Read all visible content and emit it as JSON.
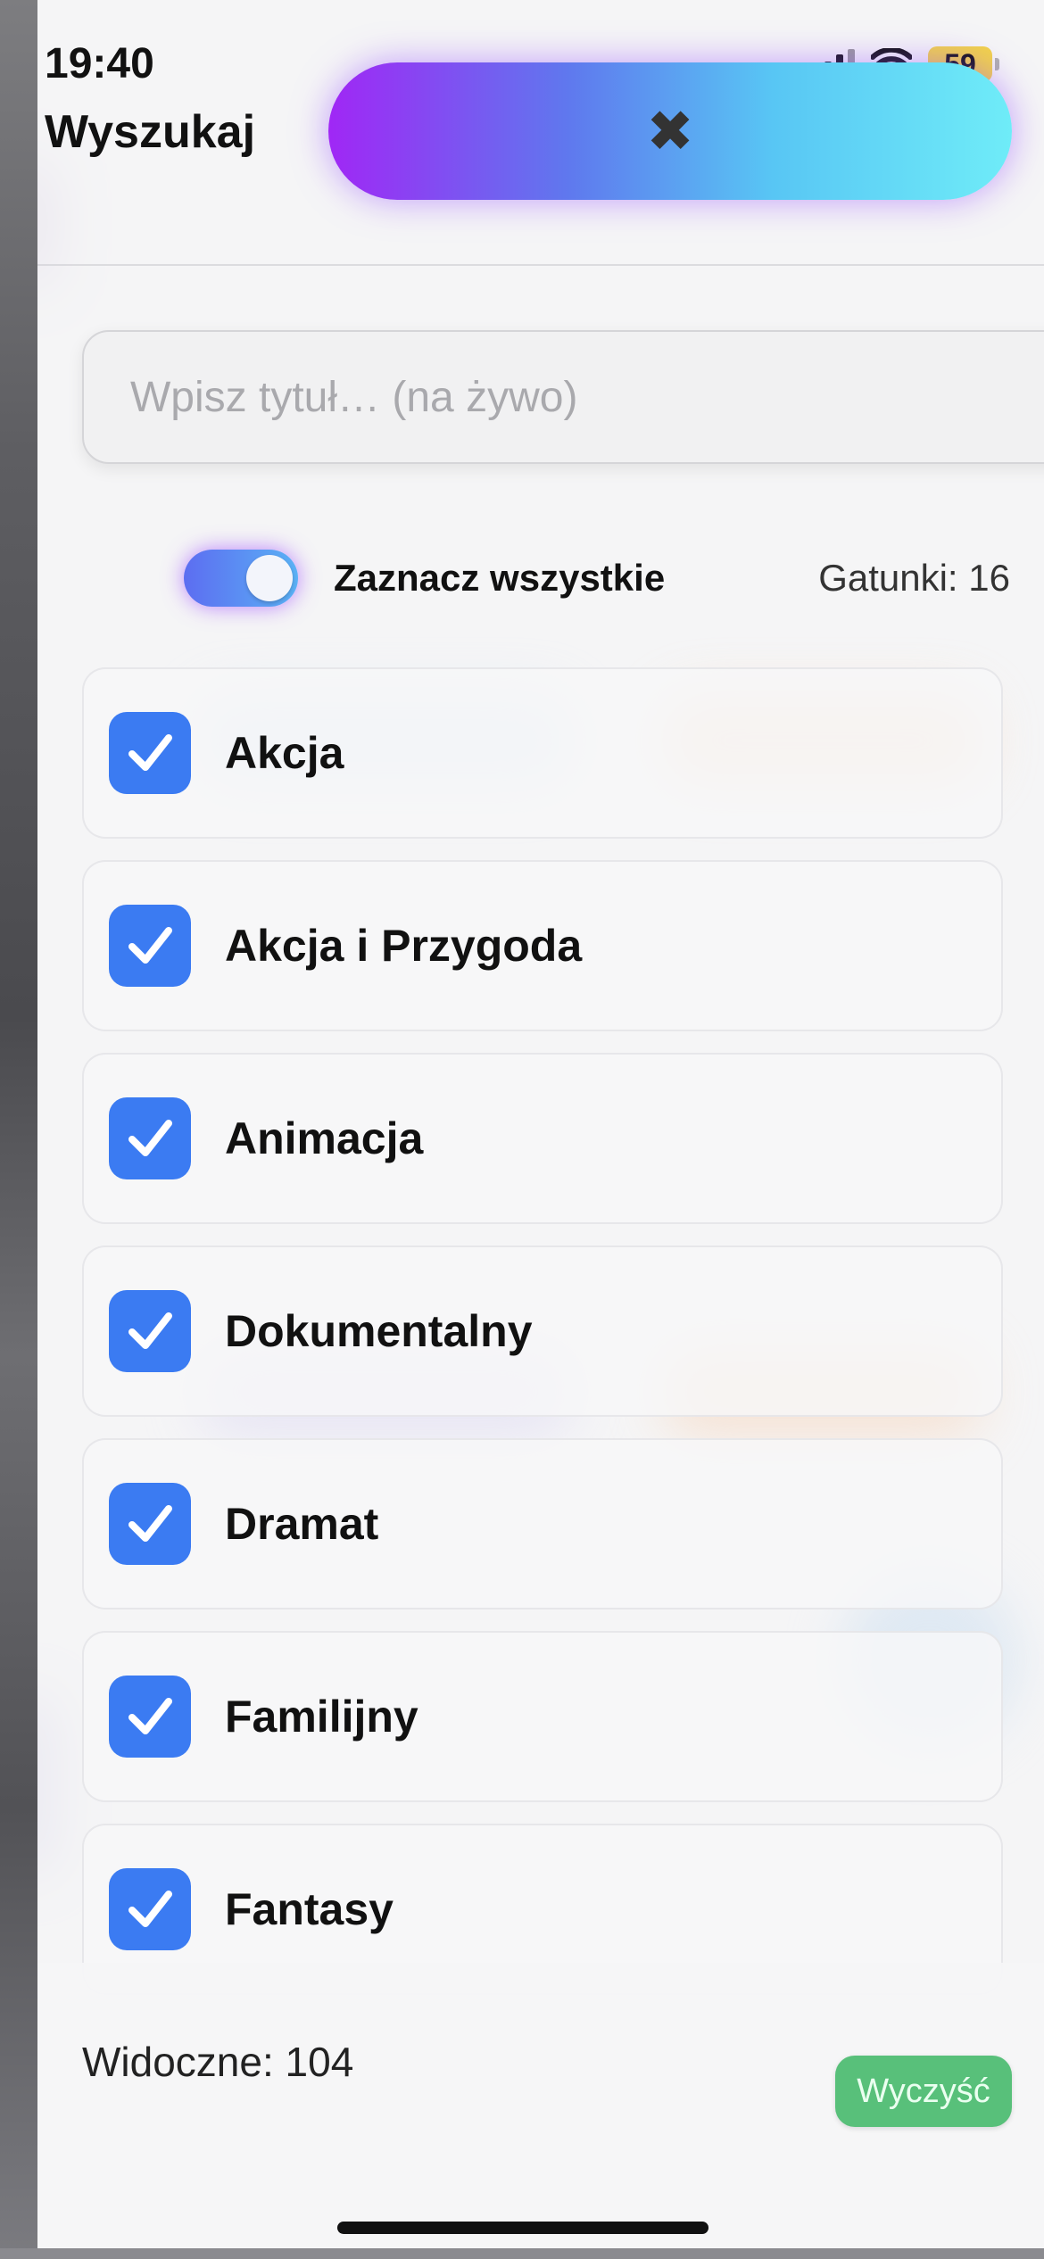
{
  "status_bar": {
    "time": "19:40",
    "battery": "59",
    "icons": [
      "signal-icon",
      "wifi-icon",
      "battery-icon"
    ]
  },
  "header": {
    "title": "Wyszukaj",
    "close_icon": "close-icon",
    "close_glyph": "✖"
  },
  "search": {
    "placeholder": "Wpisz tytuł… (na żywo)",
    "value": ""
  },
  "select_all": {
    "label": "Zaznacz wszystkie",
    "checked": true,
    "genre_count": "Gatunki: 16"
  },
  "genres": [
    {
      "label": "Akcja",
      "checked": true
    },
    {
      "label": "Akcja i Przygoda",
      "checked": true
    },
    {
      "label": "Animacja",
      "checked": true
    },
    {
      "label": "Dokumentalny",
      "checked": true
    },
    {
      "label": "Dramat",
      "checked": true
    },
    {
      "label": "Familijny",
      "checked": true
    },
    {
      "label": "Fantasy",
      "checked": true
    }
  ],
  "footer": {
    "visible_count": "Widoczne: 104",
    "clear_label": "Wyczyść"
  },
  "colors": {
    "accent": "#3b7bf2",
    "pill_gradient_start": "#a027f5",
    "pill_gradient_end": "#6fecf8",
    "clear_button": "#58c07a",
    "battery": "#f2d24a"
  }
}
